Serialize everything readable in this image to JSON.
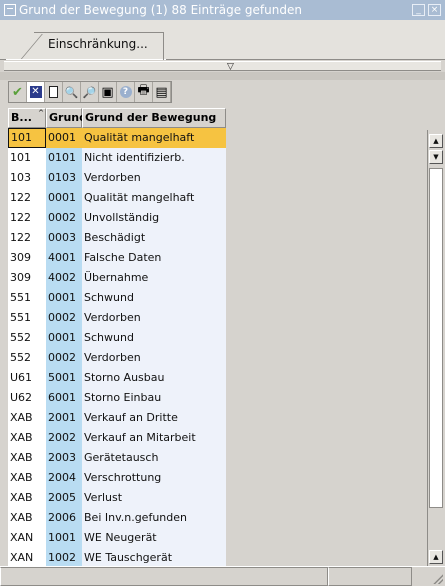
{
  "window": {
    "title": "Grund der Bewegung (1)   88 Einträge gefunden",
    "minimize_glyph": "_",
    "close_glyph": "×"
  },
  "tabs": [
    {
      "label": "Einschränkung..."
    }
  ],
  "splitter": {
    "arrow": "▽"
  },
  "toolbar": {
    "buttons": [
      {
        "icon": "check-icon",
        "glyph": "✔"
      },
      {
        "icon": "cancel-icon",
        "glyph": "✕"
      },
      {
        "icon": "new-document-icon",
        "glyph": ""
      },
      {
        "icon": "find-icon",
        "glyph": "🔍"
      },
      {
        "icon": "find-next-icon",
        "glyph": "🔎"
      },
      {
        "icon": "select-icon",
        "glyph": "▣"
      },
      {
        "icon": "help-icon",
        "glyph": "?"
      },
      {
        "icon": "print-icon",
        "glyph": "🖶"
      },
      {
        "icon": "export-icon",
        "glyph": "▤"
      }
    ]
  },
  "table": {
    "columns": [
      "B...",
      "Grund",
      "Grund der Bewegung"
    ],
    "rows": [
      [
        "101",
        "0001",
        "Qualität mangelhaft"
      ],
      [
        "101",
        "0101",
        "Nicht identifizierb."
      ],
      [
        "103",
        "0103",
        "Verdorben"
      ],
      [
        "122",
        "0001",
        "Qualität mangelhaft"
      ],
      [
        "122",
        "0002",
        "Unvollständig"
      ],
      [
        "122",
        "0003",
        "Beschädigt"
      ],
      [
        "309",
        "4001",
        "Falsche Daten"
      ],
      [
        "309",
        "4002",
        "Übernahme"
      ],
      [
        "551",
        "0001",
        "Schwund"
      ],
      [
        "551",
        "0002",
        "Verdorben"
      ],
      [
        "552",
        "0001",
        "Schwund"
      ],
      [
        "552",
        "0002",
        "Verdorben"
      ],
      [
        "U61",
        "5001",
        "Storno Ausbau"
      ],
      [
        "U62",
        "6001",
        "Storno Einbau"
      ],
      [
        "XAB",
        "2001",
        "Verkauf an Dritte"
      ],
      [
        "XAB",
        "2002",
        "Verkauf an Mitarbeit"
      ],
      [
        "XAB",
        "2003",
        "Gerätetausch"
      ],
      [
        "XAB",
        "2004",
        "Verschrottung"
      ],
      [
        "XAB",
        "2005",
        "Verlust"
      ],
      [
        "XAB",
        "2006",
        "Bei Inv.n.gefunden"
      ],
      [
        "XAN",
        "1001",
        "WE Neugerät"
      ],
      [
        "XAN",
        "1002",
        "WE Tauschgerät"
      ]
    ],
    "selected_row": 0
  },
  "colors": {
    "title_bar": "#a9bcd3",
    "selected_row": "#f6c341",
    "key_column": "#b9dcf2",
    "text_column": "#eef2fa"
  }
}
